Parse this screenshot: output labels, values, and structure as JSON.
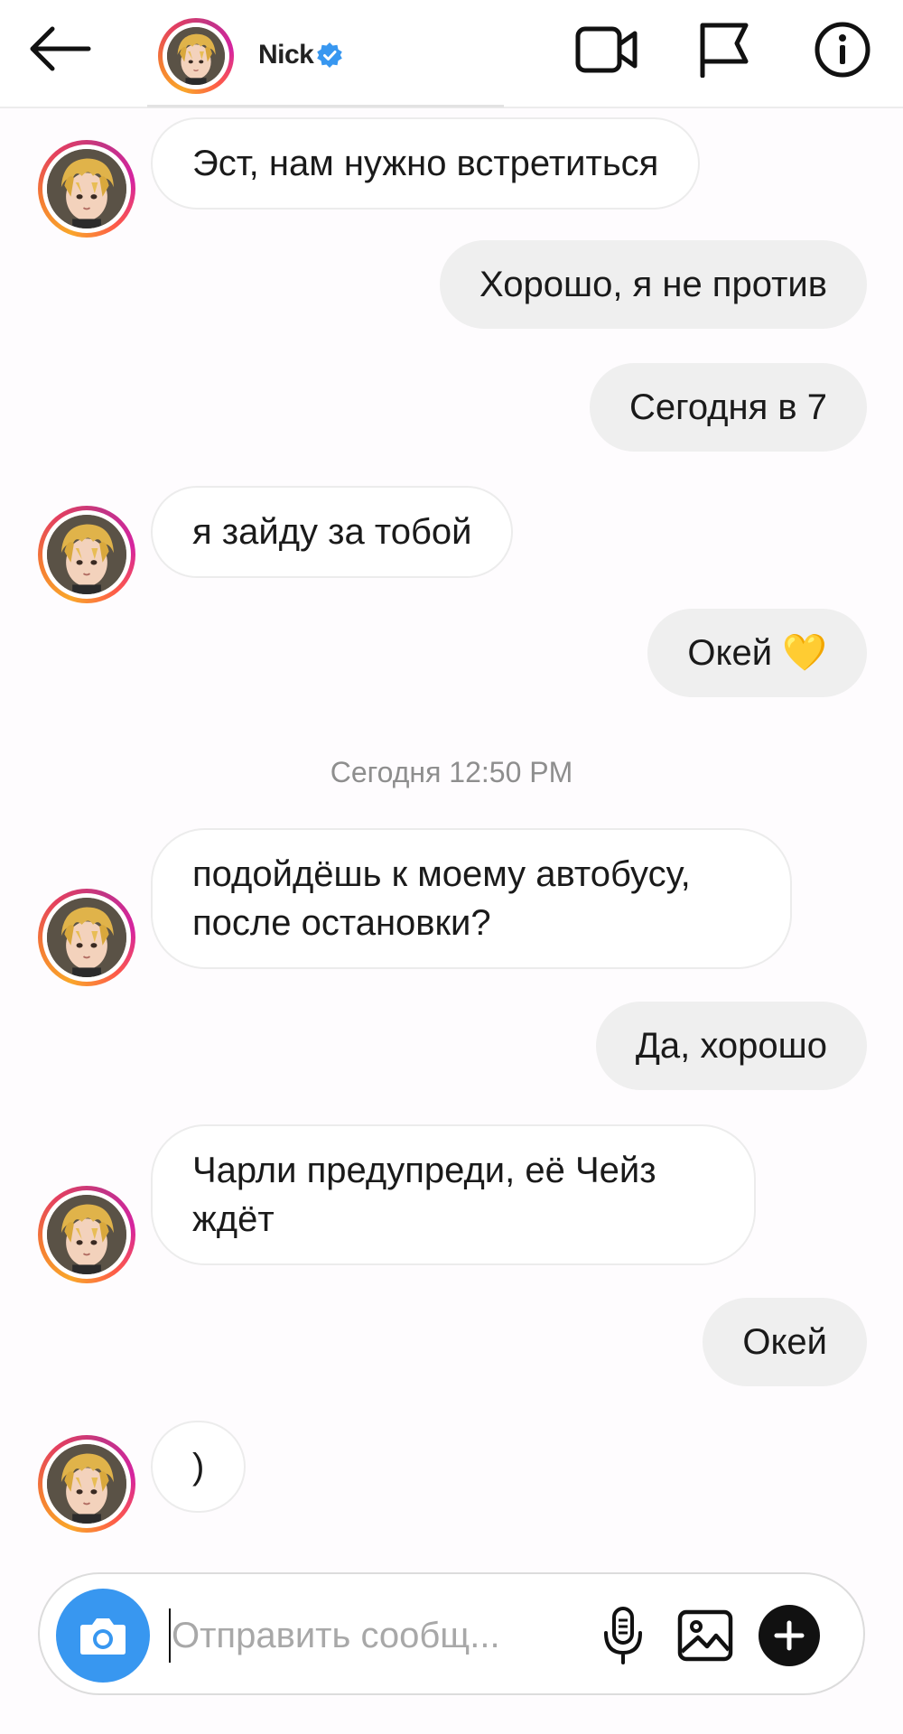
{
  "header": {
    "title": "Nick",
    "verified": true,
    "icons": [
      "back-arrow-icon",
      "video-call-icon",
      "flag-icon",
      "info-icon"
    ]
  },
  "messages": [
    {
      "side": "in",
      "text": "Эст, нам нужно встретиться"
    },
    {
      "side": "out",
      "text": "Хорошо, я не против"
    },
    {
      "side": "out",
      "text": "Сегодня в 7"
    },
    {
      "side": "in",
      "text": "я зайду за тобой"
    },
    {
      "side": "out",
      "text": "Окей 💛"
    },
    {
      "side": "in",
      "text": "подойдёшь к моему автобусу, после остановки?"
    },
    {
      "side": "out",
      "text": "Да, хорошо"
    },
    {
      "side": "in",
      "text": "Чарли предупреди, её Чейз ждёт"
    },
    {
      "side": "out",
      "text": "Окей"
    },
    {
      "side": "in",
      "text": ")"
    }
  ],
  "timestamp": "Сегодня 12:50 PM",
  "composer": {
    "placeholder": "Отправить сообщ...",
    "value": "",
    "icons": [
      "camera-icon",
      "microphone-icon",
      "gallery-icon",
      "plus-icon"
    ]
  },
  "colors": {
    "accent": "#3897f0",
    "outgoing_bubble": "#efefef",
    "incoming_bubble": "#ffffff",
    "timestamp": "#8e8e8e"
  }
}
